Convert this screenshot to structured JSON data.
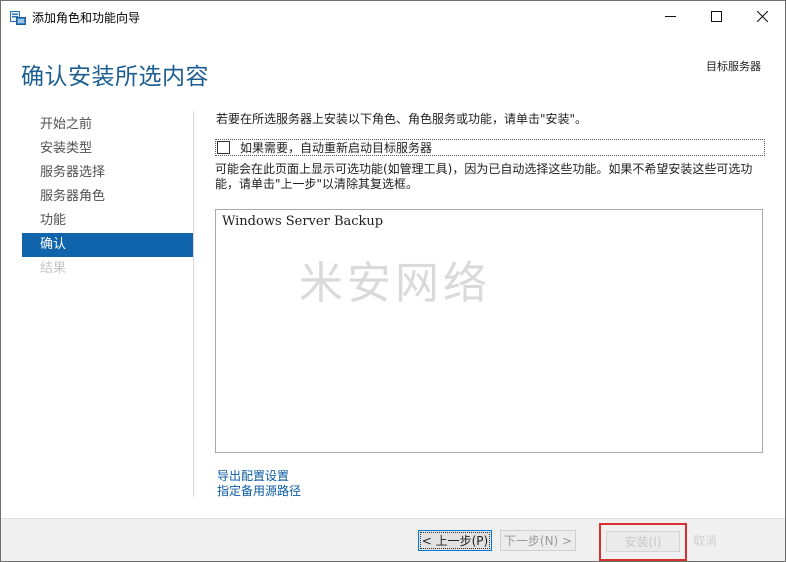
{
  "window": {
    "title": "添加角色和功能向导",
    "controls": [
      "minimize-icon",
      "maximize-icon",
      "close-icon"
    ]
  },
  "header": {
    "page_title": "确认安装所选内容",
    "target_server_label": "目标服务器"
  },
  "nav": {
    "items": [
      {
        "label": "开始之前",
        "state": "normal"
      },
      {
        "label": "安装类型",
        "state": "normal"
      },
      {
        "label": "服务器选择",
        "state": "normal"
      },
      {
        "label": "服务器角色",
        "state": "normal"
      },
      {
        "label": "功能",
        "state": "normal"
      },
      {
        "label": "确认",
        "state": "selected"
      },
      {
        "label": "结果",
        "state": "disabled"
      }
    ]
  },
  "main": {
    "instruction": "若要在所选服务器上安装以下角色、角色服务或功能，请单击\"安装\"。",
    "restart_checkbox": {
      "label": "如果需要，自动重新启动目标服务器",
      "checked": false
    },
    "note": "可能会在此页面上显示可选功能(如管理工具)，因为已自动选择这些功能。如果不希望安装这些可选功能，请单击\"上一步\"以清除其复选框。",
    "features": [
      "Windows Server Backup"
    ],
    "watermark": "米安网络",
    "links": {
      "export": "导出配置设置",
      "alternate_source": "指定备用源路径"
    }
  },
  "footer": {
    "prev_label": "< 上一步(P)",
    "next_label": "下一步(N) >",
    "install_label": "安装(I)",
    "cancel_label": "取消"
  },
  "colors": {
    "accent": "#0f64ab",
    "title": "#1b5e8f",
    "link": "#0b5aa3",
    "highlight_border": "#d83030"
  }
}
